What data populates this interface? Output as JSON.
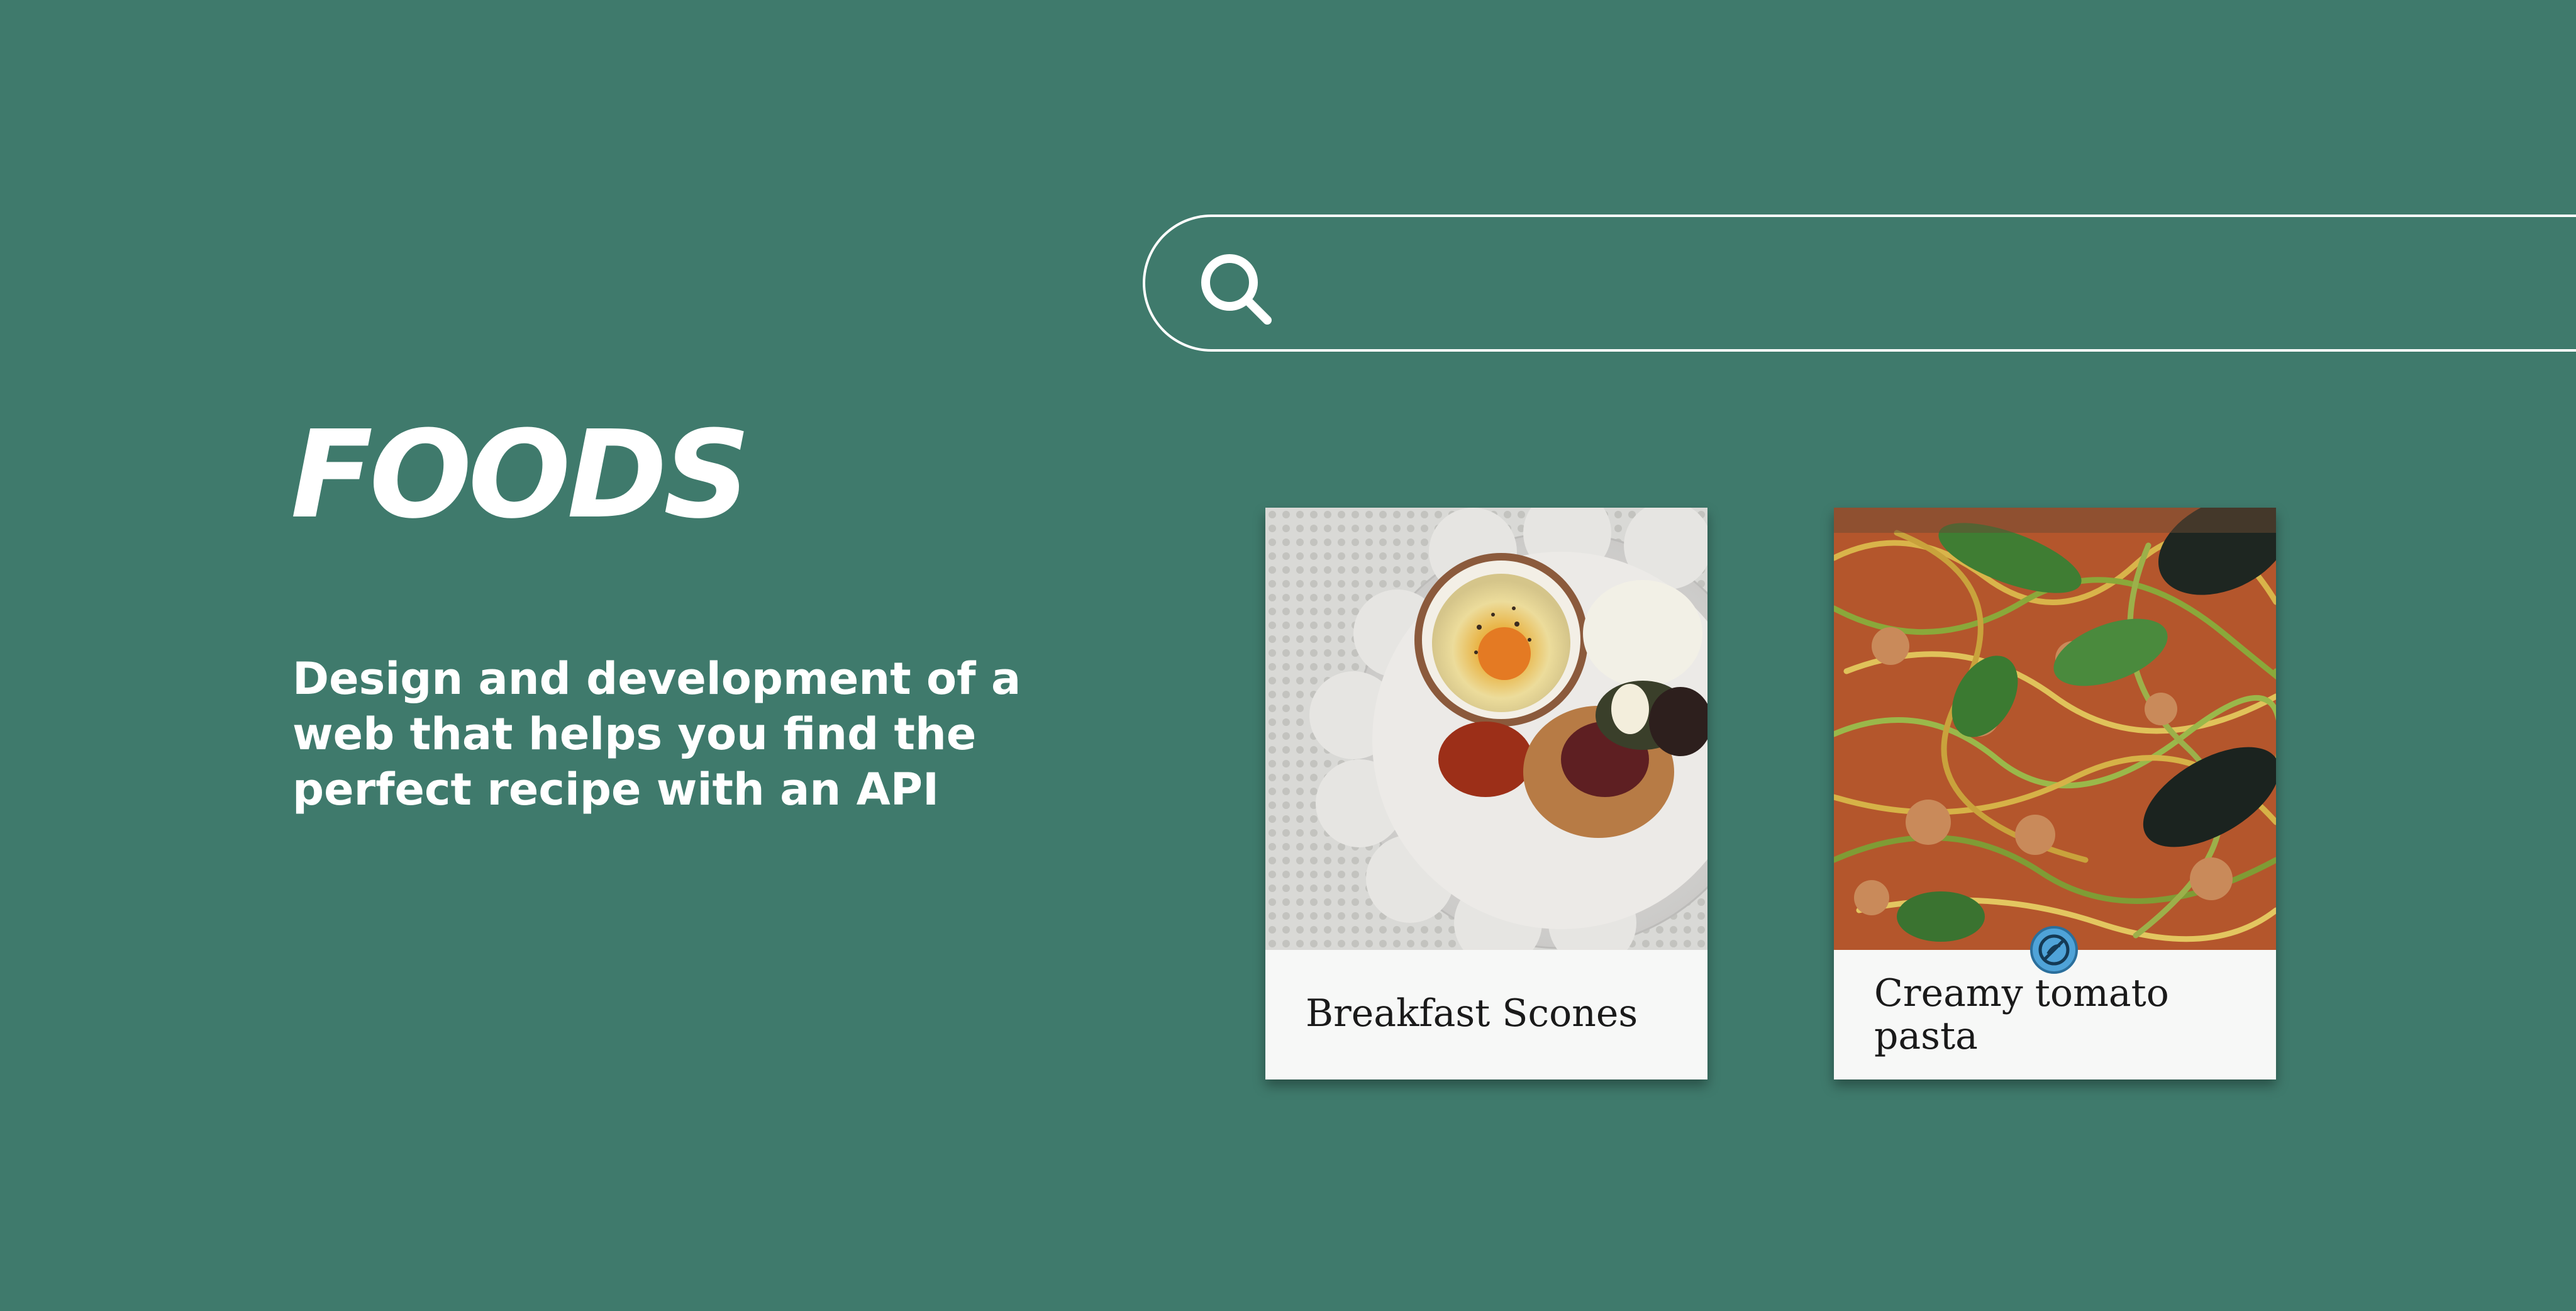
{
  "search": {
    "placeholder": "",
    "value": "",
    "icon": "search-icon"
  },
  "hero": {
    "title": "FOODS",
    "description": "Design and development of a web that helps you find the perfect recipe with an API"
  },
  "recipes": [
    {
      "title": "Breakfast Scones",
      "image": "breakfast-scones-photo"
    },
    {
      "title": "Creamy tomato pasta",
      "image": "creamy-tomato-pasta-photo",
      "badge_icon": "no-gluten-icon"
    }
  ],
  "colors": {
    "background": "#3f7a6c",
    "card": "#f7f8f7",
    "badge": "#4fa3d8",
    "text": "#ffffff"
  }
}
